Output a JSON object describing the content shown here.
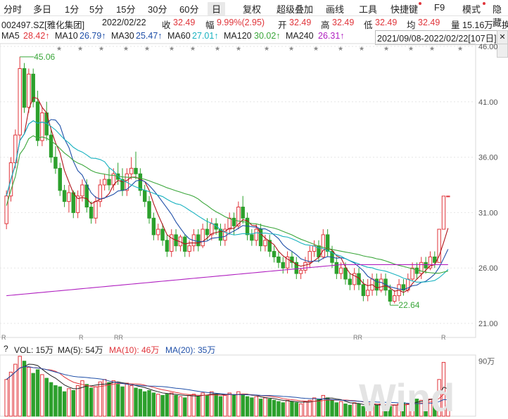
{
  "toolbar": {
    "items": [
      "分时",
      "多日",
      "1分",
      "5分",
      "15分",
      "30分",
      "60分",
      "日",
      "复权",
      "超级叠加",
      "画线",
      "工具",
      "快捷键",
      "F9",
      "模式",
      "隐藏"
    ],
    "active": "日"
  },
  "quote": {
    "code_name": "002497.SZ[雅化集团]",
    "date": "2022/02/22",
    "close_label": "收",
    "close": "32.49",
    "change_label": "幅",
    "change": "9.99%(2.95)",
    "open_label": "开",
    "open": "32.49",
    "high_label": "高",
    "high": "32.49",
    "low_label": "低",
    "low": "32.49",
    "avg_label": "均",
    "avg": "32.49",
    "vol_label": "量",
    "vol": "15.16万",
    "extra": "换"
  },
  "ma": {
    "ma5_label": "MA5",
    "ma5": "28.42↑",
    "ma10_label": "MA10",
    "ma10": "26.79↑",
    "ma30_label": "MA30",
    "ma30": "25.47↑",
    "ma60_label": "MA60",
    "ma60": "27.01↑",
    "ma120_label": "MA120",
    "ma120": "30.02↑",
    "ma240_label": "MA240",
    "ma240": "26.31↑",
    "range": "2021/09/08-2022/02/22[107日]",
    "side_btn": "✕"
  },
  "volume": {
    "help": "?",
    "vol_label": "VOL: 15万",
    "ma5": "MA(5): 54万",
    "ma10": "MA(10): 46万",
    "ma20": "MA(20): 35万",
    "axis_label": "90万"
  },
  "colors": {
    "up": "#e0353b",
    "down": "#2ca02c",
    "ma5": "#b0141a",
    "ma10": "#1f4fa8",
    "ma30": "#18b2c0",
    "ma60": "#3aa63a",
    "ma120": "#3aa63a",
    "ma240": "#b020c0"
  },
  "annotations": {
    "high": "45.06",
    "low": "22.64"
  },
  "watermark": "Wind",
  "chart_data": {
    "type": "candlestick",
    "y_axis": {
      "ticks": [
        "46.00",
        "41.00",
        "36.00",
        "31.00",
        "26.00",
        "21.00"
      ],
      "range": [
        21,
        46
      ]
    },
    "tick_marks_bottom": [
      "R",
      "R",
      "RR",
      "RR",
      "R"
    ],
    "candles": [
      [
        30.0,
        32.5,
        29.5,
        33.0
      ],
      [
        32.5,
        35.5,
        32.0,
        36.0
      ],
      [
        35.5,
        38.0,
        35.0,
        38.5
      ],
      [
        38.0,
        44.0,
        37.5,
        45.06
      ],
      [
        44.0,
        40.5,
        40.0,
        44.5
      ],
      [
        40.5,
        43.5,
        40.0,
        44.0
      ],
      [
        43.5,
        41.0,
        40.5,
        44.0
      ],
      [
        41.0,
        37.5,
        37.0,
        42.0
      ],
      [
        37.5,
        40.0,
        37.0,
        40.5
      ],
      [
        40.0,
        38.0,
        37.5,
        41.0
      ],
      [
        38.0,
        36.0,
        35.5,
        38.5
      ],
      [
        36.0,
        35.0,
        34.5,
        37.0
      ],
      [
        35.0,
        33.0,
        32.5,
        35.5
      ],
      [
        33.0,
        32.0,
        31.5,
        33.5
      ],
      [
        32.0,
        32.8,
        31.0,
        33.5
      ],
      [
        32.8,
        31.0,
        30.5,
        33.0
      ],
      [
        31.0,
        32.5,
        30.5,
        33.0
      ],
      [
        32.5,
        33.5,
        32.0,
        34.0
      ],
      [
        33.5,
        31.5,
        31.0,
        34.0
      ],
      [
        31.5,
        30.5,
        30.0,
        32.0
      ],
      [
        30.5,
        32.0,
        30.0,
        32.5
      ],
      [
        32.0,
        33.5,
        31.5,
        34.0
      ],
      [
        33.5,
        34.0,
        33.0,
        34.5
      ],
      [
        34.0,
        33.5,
        33.0,
        35.0
      ],
      [
        33.5,
        34.5,
        33.0,
        35.0
      ],
      [
        34.5,
        34.0,
        33.5,
        35.5
      ],
      [
        34.0,
        33.0,
        32.5,
        35.0
      ],
      [
        33.0,
        34.5,
        32.5,
        35.0
      ],
      [
        34.5,
        35.0,
        34.0,
        36.0
      ],
      [
        35.0,
        34.5,
        34.0,
        36.5
      ],
      [
        34.5,
        33.0,
        32.5,
        35.0
      ],
      [
        33.0,
        32.0,
        31.5,
        33.5
      ],
      [
        32.0,
        30.5,
        30.0,
        32.5
      ],
      [
        30.5,
        29.0,
        28.5,
        31.0
      ],
      [
        29.0,
        29.5,
        28.5,
        30.0
      ],
      [
        29.5,
        28.5,
        28.0,
        30.0
      ],
      [
        28.5,
        27.5,
        27.0,
        29.0
      ],
      [
        27.5,
        29.0,
        27.0,
        29.5
      ],
      [
        29.0,
        28.0,
        27.5,
        29.5
      ],
      [
        28.0,
        28.8,
        27.5,
        29.0
      ],
      [
        28.8,
        27.5,
        27.0,
        29.0
      ],
      [
        27.5,
        28.0,
        27.0,
        28.5
      ],
      [
        28.0,
        29.0,
        27.5,
        29.5
      ],
      [
        29.0,
        28.0,
        27.5,
        29.5
      ],
      [
        28.0,
        29.5,
        27.8,
        30.0
      ],
      [
        29.5,
        29.0,
        28.5,
        30.5
      ],
      [
        29.0,
        30.0,
        28.5,
        30.5
      ],
      [
        30.0,
        29.5,
        29.0,
        30.5
      ],
      [
        29.5,
        28.5,
        28.0,
        30.0
      ],
      [
        28.5,
        29.5,
        28.0,
        30.0
      ],
      [
        29.5,
        30.5,
        29.0,
        31.0
      ],
      [
        30.5,
        29.8,
        29.0,
        31.0
      ],
      [
        29.8,
        31.5,
        29.5,
        32.0
      ],
      [
        31.5,
        30.5,
        30.0,
        32.5
      ],
      [
        30.5,
        29.0,
        28.5,
        31.0
      ],
      [
        29.0,
        28.5,
        28.0,
        29.5
      ],
      [
        28.5,
        29.5,
        28.0,
        30.0
      ],
      [
        29.5,
        28.0,
        27.5,
        30.0
      ],
      [
        28.0,
        28.5,
        27.5,
        29.0
      ],
      [
        28.5,
        27.5,
        27.0,
        29.0
      ],
      [
        27.5,
        27.0,
        26.5,
        28.0
      ],
      [
        27.0,
        26.5,
        26.0,
        27.5
      ],
      [
        26.5,
        26.0,
        25.5,
        27.0
      ],
      [
        26.0,
        27.0,
        25.5,
        27.5
      ],
      [
        27.0,
        26.5,
        26.0,
        27.5
      ],
      [
        26.5,
        25.5,
        25.0,
        27.0
      ],
      [
        25.5,
        25.8,
        25.0,
        26.0
      ],
      [
        25.8,
        26.5,
        25.5,
        27.0
      ],
      [
        26.5,
        27.5,
        26.0,
        28.0
      ],
      [
        27.5,
        28.0,
        27.0,
        28.5
      ],
      [
        28.0,
        27.0,
        26.5,
        28.5
      ],
      [
        27.0,
        29.0,
        26.8,
        29.5
      ],
      [
        29.0,
        27.5,
        27.0,
        29.5
      ],
      [
        27.5,
        26.5,
        26.0,
        28.0
      ],
      [
        26.5,
        25.5,
        25.0,
        27.0
      ],
      [
        25.5,
        26.0,
        25.0,
        26.5
      ],
      [
        26.0,
        25.0,
        24.5,
        26.5
      ],
      [
        25.0,
        24.5,
        24.0,
        25.5
      ],
      [
        24.5,
        25.5,
        24.0,
        26.0
      ],
      [
        25.5,
        24.5,
        24.0,
        26.0
      ],
      [
        24.5,
        23.5,
        23.0,
        25.0
      ],
      [
        23.5,
        24.0,
        23.0,
        25.0
      ],
      [
        24.0,
        25.0,
        23.5,
        25.5
      ],
      [
        25.0,
        24.0,
        23.5,
        25.5
      ],
      [
        24.0,
        25.0,
        23.8,
        25.5
      ],
      [
        25.0,
        24.0,
        23.5,
        25.5
      ],
      [
        24.0,
        23.0,
        22.64,
        24.5
      ],
      [
        23.0,
        23.5,
        22.8,
        24.0
      ],
      [
        23.5,
        24.5,
        23.0,
        25.0
      ],
      [
        24.5,
        24.0,
        23.5,
        25.0
      ],
      [
        24.0,
        25.0,
        23.8,
        25.5
      ],
      [
        25.0,
        26.0,
        24.8,
        26.5
      ],
      [
        26.0,
        25.5,
        25.0,
        26.5
      ],
      [
        25.5,
        26.5,
        25.0,
        27.0
      ],
      [
        26.5,
        26.0,
        25.5,
        27.0
      ],
      [
        26.0,
        27.0,
        25.8,
        27.5
      ],
      [
        27.0,
        26.5,
        26.0,
        27.5
      ],
      [
        26.5,
        29.5,
        26.5,
        29.5
      ],
      [
        29.5,
        32.49,
        29.5,
        32.49
      ],
      [
        32.49,
        32.49,
        32.49,
        32.49
      ]
    ],
    "volumes": [
      60,
      72,
      85,
      98,
      90,
      80,
      70,
      76,
      68,
      62,
      55,
      50,
      48,
      40,
      45,
      42,
      50,
      58,
      52,
      46,
      48,
      56,
      60,
      55,
      58,
      52,
      48,
      54,
      50,
      46,
      44,
      40,
      42,
      38,
      36,
      34,
      36,
      38,
      34,
      32,
      30,
      34,
      36,
      32,
      38,
      34,
      40,
      36,
      32,
      34,
      38,
      34,
      40,
      36,
      32,
      30,
      32,
      28,
      30,
      28,
      26,
      24,
      22,
      26,
      24,
      22,
      20,
      24,
      26,
      30,
      28,
      34,
      30,
      26,
      22,
      24,
      20,
      18,
      22,
      20,
      16,
      18,
      20,
      18,
      20,
      18,
      16,
      18,
      20,
      22,
      20,
      24,
      28,
      26,
      30,
      28,
      32,
      60,
      88,
      15
    ],
    "vol_axis": {
      "ticks": [
        "90万"
      ]
    }
  }
}
